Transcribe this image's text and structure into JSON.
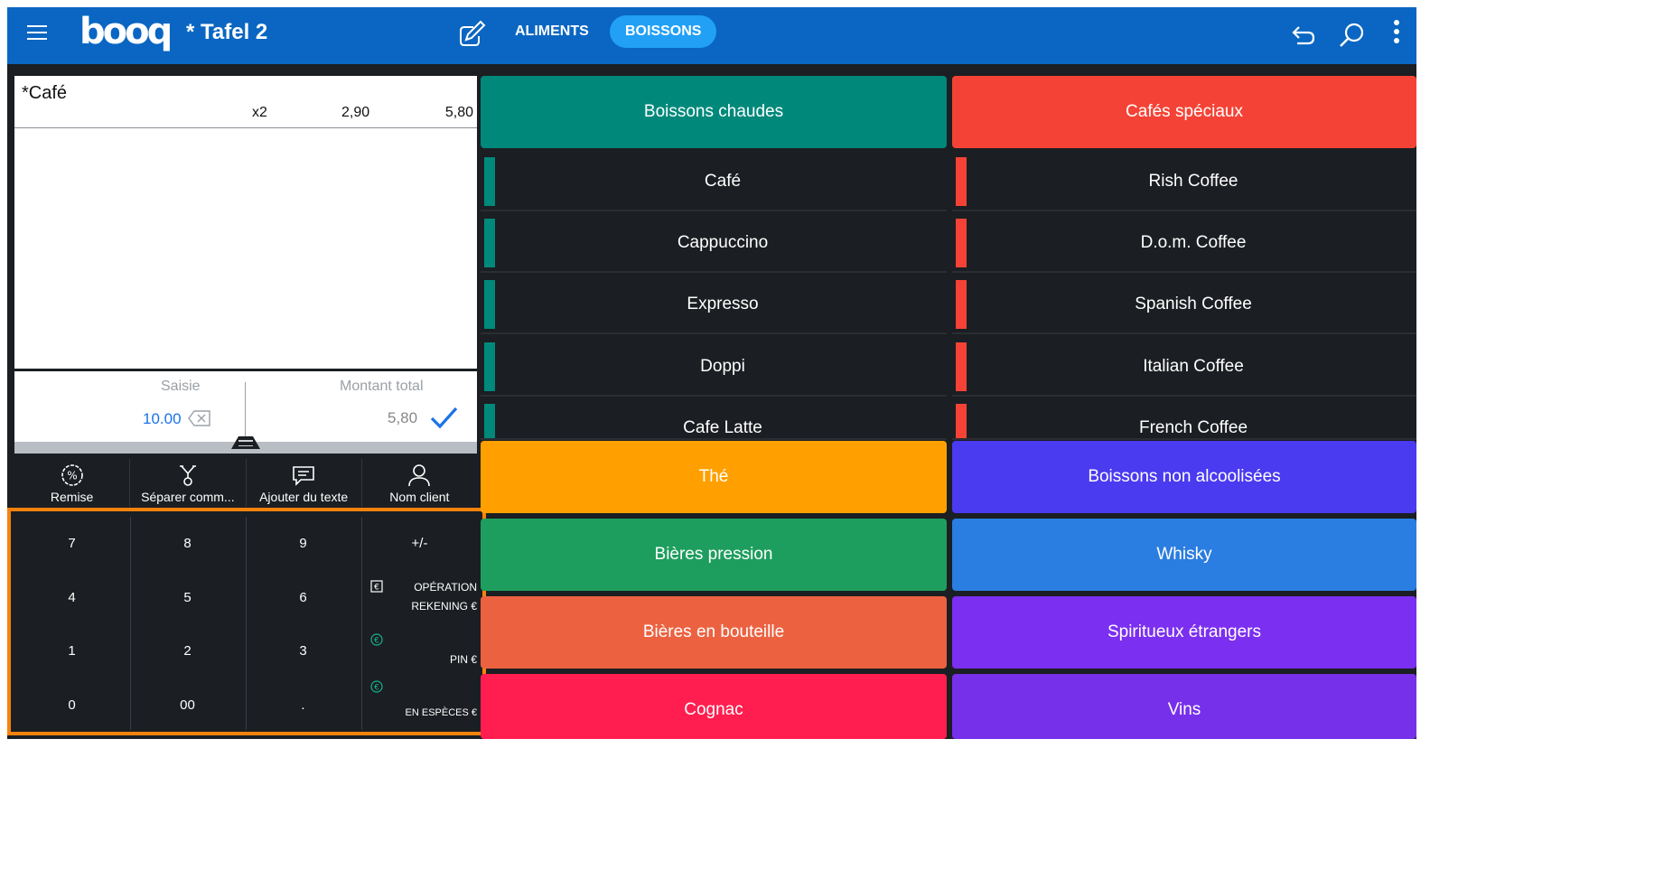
{
  "topbar": {
    "logo": "booq",
    "title": "* Tafel 2",
    "tabs": [
      {
        "label": "ALIMENTS",
        "active": false
      },
      {
        "label": "BOISSONS",
        "active": true
      }
    ],
    "icons": [
      "menu-icon",
      "edit-icon",
      "undo-icon",
      "search-icon",
      "more-icon"
    ]
  },
  "order": {
    "lines": [
      {
        "name": "*Café",
        "qty": "x2",
        "price": "2,90",
        "total": "5,80"
      }
    ]
  },
  "summary": {
    "entry_label": "Saisie",
    "entry_value": "10.00",
    "total_label": "Montant total",
    "total_value": "5,80"
  },
  "actions": [
    {
      "label": "Remise",
      "icon": "discount-icon"
    },
    {
      "label": "Séparer comm...",
      "icon": "split-icon"
    },
    {
      "label": "Ajouter du texte",
      "icon": "comment-icon"
    },
    {
      "label": "Nom client",
      "icon": "user-icon"
    }
  ],
  "keypad": {
    "keys": [
      "7",
      "8",
      "9",
      "4",
      "5",
      "6",
      "1",
      "2",
      "3",
      "0",
      "00",
      "."
    ],
    "plus_minus": "+/-",
    "functions": [
      {
        "line1": "OPÉRATION",
        "line2": "REKENING €",
        "icon": "invoice-icon"
      },
      {
        "line1": "",
        "line2": "PIN €",
        "icon": "euro-icon"
      },
      {
        "line1": "",
        "line2": "EN ESPÈCES €",
        "icon": "euro-icon"
      }
    ]
  },
  "categories": {
    "boissons_chaudes": {
      "label": "Boissons chaudes",
      "color": "#00897b"
    },
    "cafes_speciaux": {
      "label": "Cafés spéciaux",
      "color": "#f44336"
    },
    "the": {
      "label": "Thé",
      "color": "#ffa000"
    },
    "non_alcoolisees": {
      "label": "Boissons non alcoolisées",
      "color": "#4a3af0"
    },
    "bieres_pression": {
      "label": "Bières pression",
      "color": "#1e9e5e"
    },
    "whisky": {
      "label": "Whisky",
      "color": "#2a7de1"
    },
    "bieres_bouteille": {
      "label": "Bières en bouteille",
      "color": "#ec6240"
    },
    "spiritueux": {
      "label": "Spiritueux étrangers",
      "color": "#7b2ff0"
    },
    "cognac": {
      "label": "Cognac",
      "color": "#ff1e4f"
    },
    "vins": {
      "label": "Vins",
      "color": "#7730ea"
    }
  },
  "products_left": [
    "Café",
    "Cappuccino",
    "Expresso",
    "Doppi",
    "Cafe Latte"
  ],
  "products_right": [
    "Rish Coffee",
    "D.o.m. Coffee",
    "Spanish Coffee",
    "Italian Coffee",
    "French Coffee"
  ],
  "colors": {
    "accent": "#0a66c2",
    "active_tab": "#21a0f6",
    "highlight_border": "#f5820d",
    "check": "#1a73e8"
  }
}
